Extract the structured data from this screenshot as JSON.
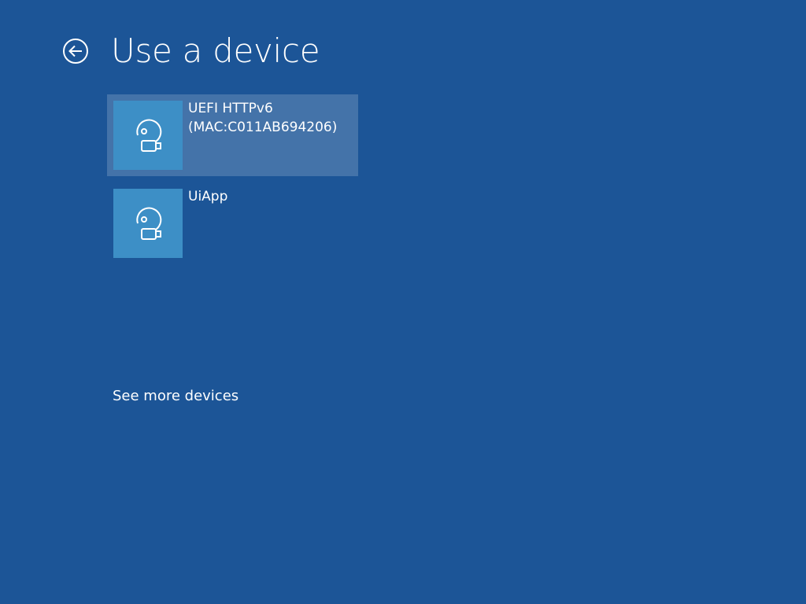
{
  "header": {
    "back_icon": "back-arrow-circle-icon",
    "title": "Use a device"
  },
  "devices": [
    {
      "label": "UEFI HTTPv6\n(MAC:C011AB694206)",
      "icon": "disc-usb-drive-icon",
      "selected": true
    },
    {
      "label": "UiApp",
      "icon": "disc-usb-drive-icon",
      "selected": false
    }
  ],
  "footer": {
    "see_more_label": "See more devices"
  },
  "colors": {
    "background": "#1c5597",
    "tile_icon_background": "#3d8fc6",
    "text": "#ffffff"
  }
}
